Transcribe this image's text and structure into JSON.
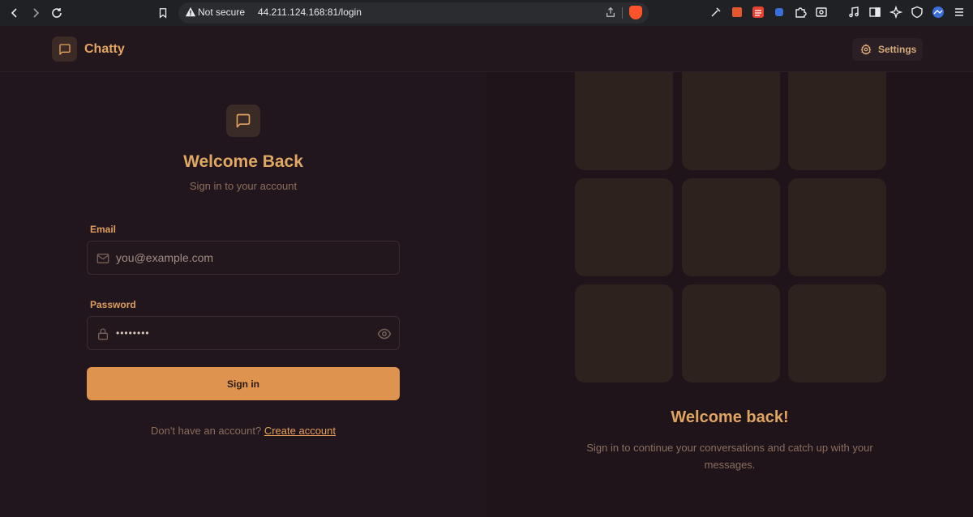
{
  "browser": {
    "security_label": "Not secure",
    "url": "44.211.124.168:81/login"
  },
  "header": {
    "brand": "Chatty",
    "settings_label": "Settings"
  },
  "login": {
    "title": "Welcome Back",
    "subtitle": "Sign in to your account",
    "email_label": "Email",
    "email_placeholder": "you@example.com",
    "password_label": "Password",
    "password_value": "••••••••",
    "submit_label": "Sign in",
    "signup_prompt": "Don't have an account?",
    "signup_link": "Create account"
  },
  "promo": {
    "title": "Welcome back!",
    "text": "Sign in to continue your conversations and catch up with your messages."
  },
  "colors": {
    "accent": "#de944e",
    "brand_text": "#e4a561",
    "background": "#21161d"
  },
  "icons": [
    "back-icon",
    "forward-icon",
    "reload-icon",
    "bookmark-icon",
    "warning-icon",
    "share-icon",
    "message-square-icon",
    "gear-icon",
    "mail-icon",
    "lock-icon",
    "eye-icon"
  ]
}
